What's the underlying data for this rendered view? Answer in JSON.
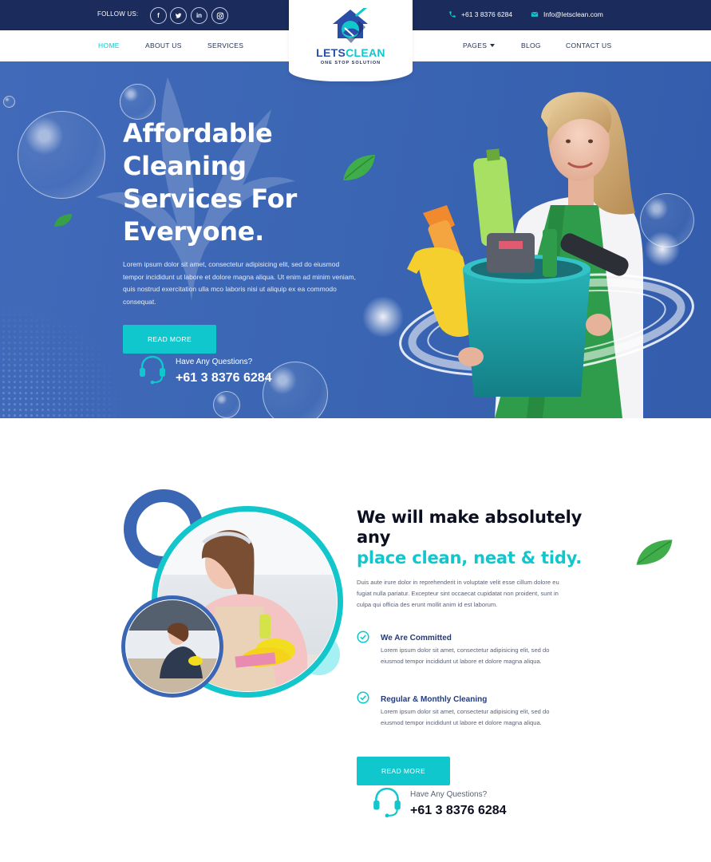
{
  "topbar": {
    "follow_label": "FOLLOW US:",
    "social": [
      {
        "icon": "facebook-icon",
        "glyph": "f"
      },
      {
        "icon": "twitter-icon",
        "glyph": "t"
      },
      {
        "icon": "linkedin-icon",
        "glyph": "in"
      },
      {
        "icon": "instagram-icon",
        "glyph": "◎"
      }
    ],
    "phone": "+61 3 8376 6284",
    "email": "Info@letsclean.com"
  },
  "nav": {
    "left": [
      "HOME",
      "ABOUT US",
      "SERVICES"
    ],
    "right": [
      "PAGES",
      "BLOG",
      "CONTACT US"
    ],
    "active": "HOME"
  },
  "logo": {
    "word_a": "LETS",
    "word_b": "CLEAN",
    "tagline": "ONE STOP SOLUTION"
  },
  "hero": {
    "title": "Affordable Cleaning Services For Everyone.",
    "description": "Lorem ipsum dolor sit amet, consectetur adipisicing elit, sed do eiusmod tempor incididunt ut labore et dolore magna aliqua. Ut enim ad minim veniam, quis nostrud exercitation ulla mco laboris nisi ut aliquip ex ea commodo consequat.",
    "button": "READ MORE",
    "question_label": "Have Any Questions?",
    "question_phone": "+61 3 8376 6284"
  },
  "about": {
    "title_line1": "We will make absolutely any",
    "title_line2": "place clean, neat & tidy.",
    "description": "Duis aute irure dolor in reprehenderit in voluptate velit esse cillum dolore eu fugiat nulla pariatur. Excepteur sint occaecat cupidatat non proident, sunt in culpa qui officia des erunt mollit anim id est laborum.",
    "features": [
      {
        "title": "We Are Committed",
        "text": "Lorem ipsum dolor sit amet, consectetur adipisicing elit, sed do eiusmod tempor incididunt ut labore et dolore magna aliqua."
      },
      {
        "title": "Regular & Monthly Cleaning",
        "text": "Lorem ipsum dolor sit amet, consectetur adipisicing elit, sed do eiusmod tempor incididunt ut labore et dolore magna aliqua."
      }
    ],
    "button": "READ MORE",
    "question_label": "Have Any Questions?",
    "question_phone": "+61 3 8376 6284"
  },
  "colors": {
    "navy": "#1a2b5c",
    "hero_blue": "#3b66b4",
    "teal": "#10c7cd",
    "dark_blue": "#2a4da8"
  }
}
